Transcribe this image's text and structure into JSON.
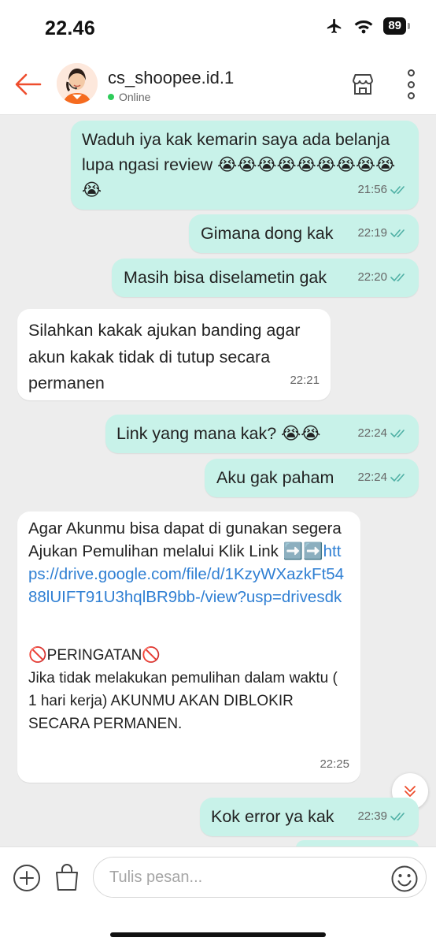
{
  "status_bar": {
    "time": "22.46",
    "battery": "89"
  },
  "header": {
    "contact_name": "cs_shoopee.id.1",
    "status": "Online",
    "accent_color": "#ee4d2d",
    "online_color": "#2ecc5a"
  },
  "messages": [
    {
      "direction": "out",
      "text": "Waduh iya kak kemarin saya ada belanja lupa ngasi review 😭😭😭😭😭😭😭😭😭😭",
      "time": "21:56",
      "read": true
    },
    {
      "direction": "out",
      "text": "Gimana dong kak",
      "time": "22:19",
      "read": true
    },
    {
      "direction": "out",
      "text": "Masih bisa diselametin gak",
      "time": "22:20",
      "read": true
    },
    {
      "direction": "in",
      "text": "Silahkan kakak ajukan banding agar akun kakak tidak di tutup secara permanen",
      "time": "22:21"
    },
    {
      "direction": "out",
      "text": "Link yang mana kak? 😭😭",
      "time": "22:24",
      "read": true
    },
    {
      "direction": "out",
      "text": "Aku gak paham",
      "time": "22:24",
      "read": true
    },
    {
      "direction": "in",
      "text_before_link": "Agar Akunmu bisa dapat di gunakan segera Ajukan Pemulihan melalui Klik Link ➡️➡️",
      "link": "https://drive.google.com/file/d/1KzyWXazkFt5488lUIFT91U3hqlBR9bb-/view?usp=drivesdk",
      "warning_title": "🚫PERINGATAN🚫",
      "warning_text": "Jika tidak melakukan pemulihan dalam waktu ( 1 hari kerja) AKUNMU AKAN DIBLOKIR SECARA PERMANEN.",
      "time": "22:25"
    },
    {
      "direction": "out",
      "text": "Kok error ya kak",
      "time": "22:39",
      "read": true
    }
  ],
  "composer": {
    "placeholder": "Tulis pesan..."
  },
  "icons": {
    "back": "back-arrow-icon",
    "shop": "shop-icon",
    "more": "more-vertical-icon",
    "scroll": "chevron-double-down-icon",
    "plus": "plus-circle-icon",
    "bag": "shopping-bag-icon",
    "emoji": "emoji-icon"
  }
}
